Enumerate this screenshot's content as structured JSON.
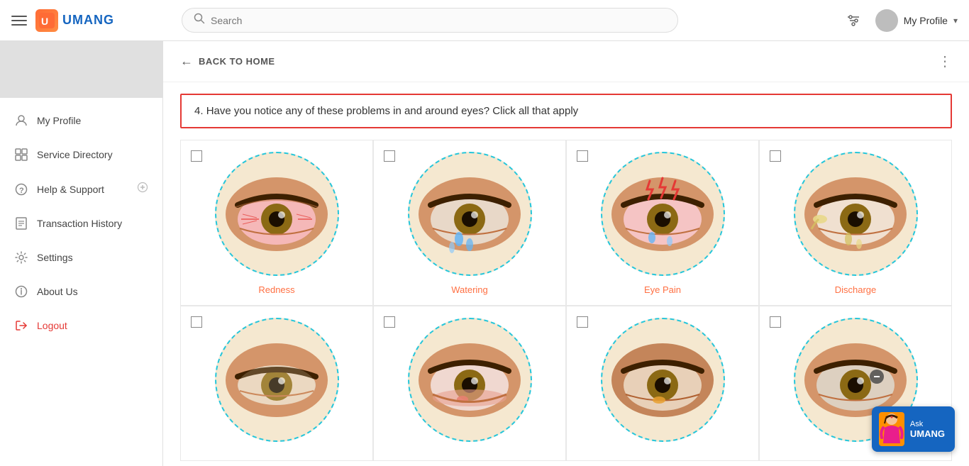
{
  "header": {
    "menu_icon": "hamburger",
    "logo_text": "UMANG",
    "logo_icon_text": "U",
    "search_placeholder": "Search",
    "filter_icon": "filter",
    "profile": {
      "name": "My Profile",
      "avatar_icon": "user",
      "chevron": "▾"
    }
  },
  "sidebar": {
    "items": [
      {
        "id": "my-profile",
        "label": "My Profile",
        "icon": "user",
        "active": false
      },
      {
        "id": "service-directory",
        "label": "Service Directory",
        "icon": "grid",
        "active": false
      },
      {
        "id": "help-support",
        "label": "Help & Support",
        "icon": "help",
        "active": false,
        "expandable": true
      },
      {
        "id": "transaction-history",
        "label": "Transaction History",
        "icon": "receipt",
        "active": false
      },
      {
        "id": "settings",
        "label": "Settings",
        "icon": "gear",
        "active": false
      },
      {
        "id": "about-us",
        "label": "About Us",
        "icon": "info",
        "active": false
      },
      {
        "id": "logout",
        "label": "Logout",
        "icon": "logout",
        "active": false
      }
    ]
  },
  "back_bar": {
    "label": "BACK TO HOME",
    "more_dots": "⋮"
  },
  "question": {
    "number": "4.",
    "text": "Have you notice any of these problems in and around eyes? Click all that apply"
  },
  "eye_options_row1": [
    {
      "id": "redness",
      "label": "Redness",
      "checked": false
    },
    {
      "id": "watering",
      "label": "Watering",
      "checked": false
    },
    {
      "id": "eye-pain",
      "label": "Eye Pain",
      "checked": false
    },
    {
      "id": "discharge",
      "label": "Discharge",
      "checked": false
    }
  ],
  "eye_options_row2": [
    {
      "id": "option5",
      "label": "",
      "checked": false
    },
    {
      "id": "option6",
      "label": "",
      "checked": false
    },
    {
      "id": "option7",
      "label": "",
      "checked": false
    },
    {
      "id": "option8",
      "label": "",
      "checked": false
    }
  ],
  "ask_umang": {
    "line1": "Ask",
    "line2": "UMANG"
  }
}
